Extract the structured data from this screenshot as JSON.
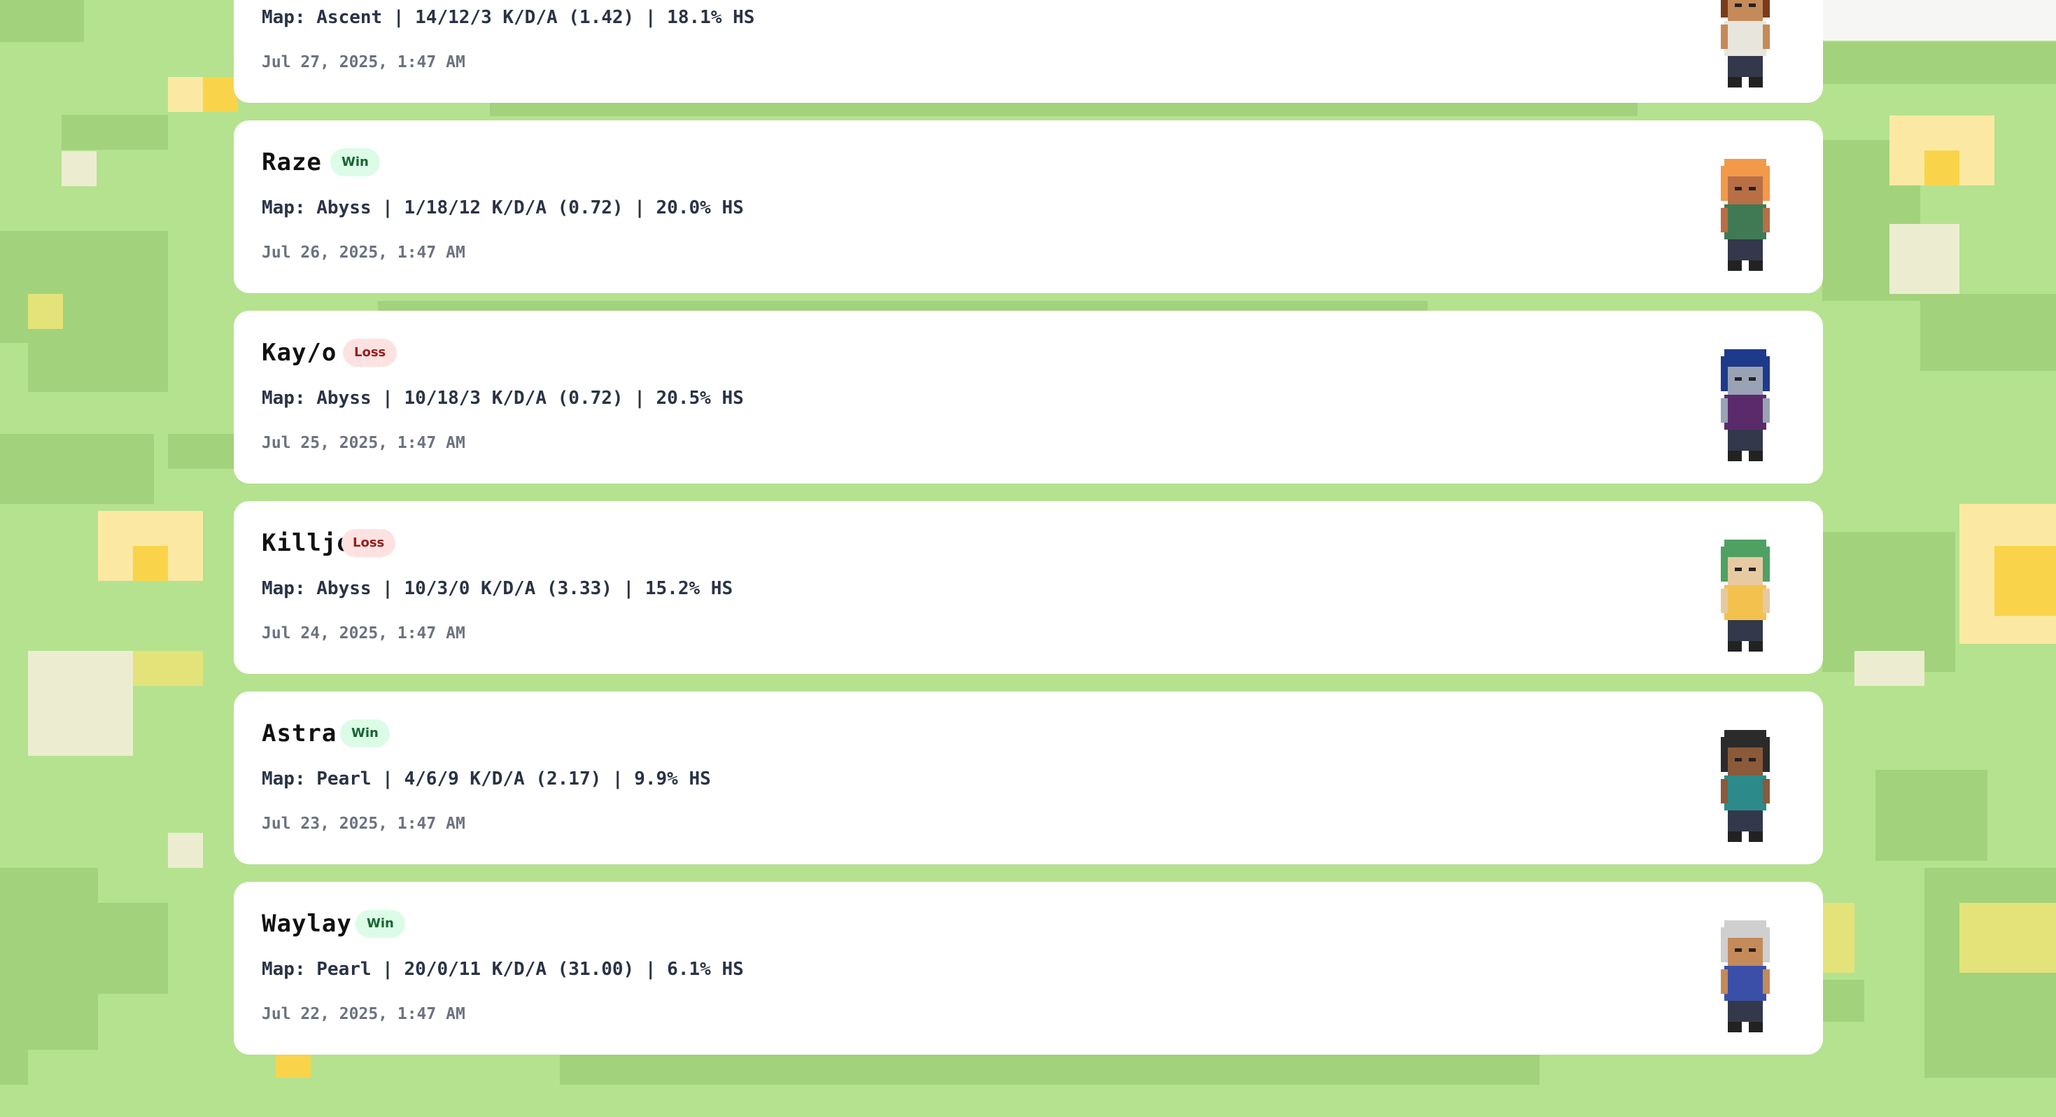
{
  "matches": [
    {
      "agent": "",
      "result": "",
      "stats": "Map: Ascent | 14/12/3 K/D/A (1.42) | 18.1% HS",
      "date": "Jul 27, 2025, 1:47 AM",
      "colors": {
        "hair": "#7a3b1a",
        "skin": "#c48a5a",
        "body": "#e8e5dc"
      }
    },
    {
      "agent": "Raze",
      "result": "Win",
      "stats": "Map: Abyss | 1/18/12 K/D/A (0.72) | 20.0% HS",
      "date": "Jul 26, 2025, 1:47 AM",
      "colors": {
        "hair": "#f2994a",
        "skin": "#b86f45",
        "body": "#3f7a55"
      }
    },
    {
      "agent": "Kay/o",
      "result": "Loss",
      "stats": "Map: Abyss | 10/18/3 K/D/A (0.72) | 20.5% HS",
      "date": "Jul 25, 2025, 1:47 AM",
      "colors": {
        "hair": "#1e3a8a",
        "skin": "#9aa3b5",
        "body": "#5b2a6b"
      }
    },
    {
      "agent": "Killjoy",
      "result": "Loss",
      "stats": "Map: Abyss | 10/3/0 K/D/A (3.33) | 15.2% HS",
      "date": "Jul 24, 2025, 1:47 AM",
      "colors": {
        "hair": "#4fa063",
        "skin": "#e7c9a2",
        "body": "#f2c14e"
      }
    },
    {
      "agent": "Astra",
      "result": "Win",
      "stats": "Map: Pearl | 4/6/9 K/D/A (2.17) | 9.9% HS",
      "date": "Jul 23, 2025, 1:47 AM",
      "colors": {
        "hair": "#2b2b2b",
        "skin": "#8a5a3b",
        "body": "#2c8a8a"
      }
    },
    {
      "agent": "Waylay",
      "result": "Win",
      "stats": "Map: Pearl | 20/0/11 K/D/A (31.00) | 6.1% HS",
      "date": "Jul 22, 2025, 1:47 AM",
      "colors": {
        "hair": "#cfcfcf",
        "skin": "#c48a5a",
        "body": "#3b4fa8"
      }
    }
  ]
}
